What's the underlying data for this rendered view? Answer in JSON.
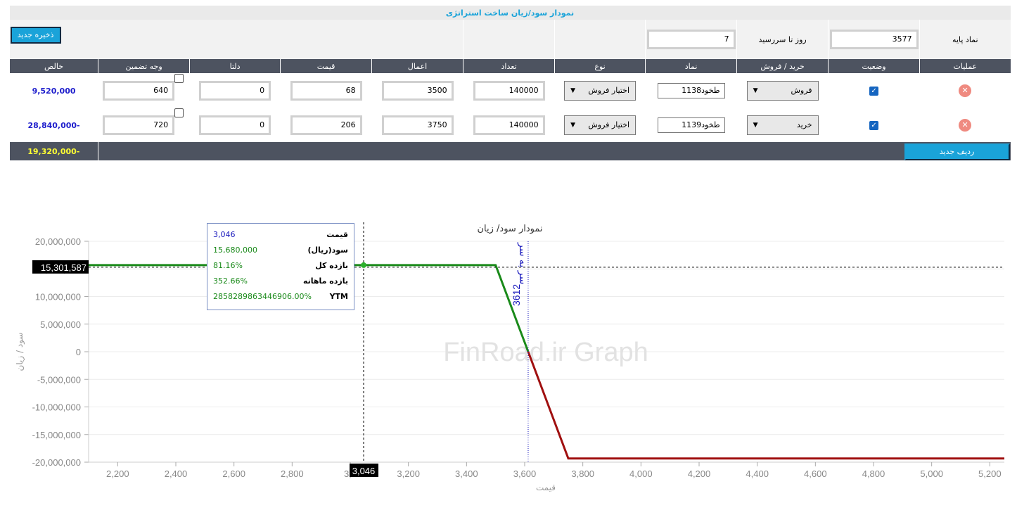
{
  "title": "نمودار سود/زیان ساخت استراتژی",
  "params": {
    "underlying_label": "نماد پایه",
    "underlying_value": "3577",
    "days_label": "روز تا سررسید",
    "days_value": "7",
    "save_label": "ذخیره جدید"
  },
  "columns": [
    "عملیات",
    "وضعیت",
    "خرید / فروش",
    "نماد",
    "نوع",
    "تعداد",
    "اعمال",
    "قیمت",
    "دلتا",
    "وجه تضمین",
    "خالص"
  ],
  "rows": [
    {
      "side": "فروش",
      "symbol": "طخود1138",
      "type": "اختیار فروش",
      "qty": "140000",
      "strike": "3500",
      "price": "68",
      "delta": "0",
      "margin": "640",
      "net": "9,520,000"
    },
    {
      "side": "خرید",
      "symbol": "طخود1139",
      "type": "اختیار فروش",
      "qty": "140000",
      "strike": "3750",
      "price": "206",
      "delta": "0",
      "margin": "720",
      "net": "-28,840,000"
    }
  ],
  "footer": {
    "net_total": "-19,320,000",
    "new_row_label": "ردیف جدید"
  },
  "icons": {
    "remove": "close-circle-icon",
    "status": "checkbox-checked-icon"
  },
  "colors": {
    "profit": "#1a8a1a",
    "loss": "#a01010",
    "header": "#4d5360",
    "accent": "#1aa3d9",
    "breakeven": "#1515bb"
  },
  "tooltip": {
    "rows": [
      {
        "label": "قیمت",
        "value": "3,046",
        "color": "#1515bb"
      },
      {
        "label": "سود(ریال)",
        "value": "15,680,000",
        "color": "#1a8a1a"
      },
      {
        "label": "بازده کل",
        "value": "81.16%",
        "color": "#1a8a1a"
      },
      {
        "label": "بازده ماهانه",
        "value": "352.66%",
        "color": "#1a8a1a"
      },
      {
        "label": "YTM",
        "value": "2858289863446906.00%",
        "color": "#1a8a1a"
      }
    ]
  },
  "chart_data": {
    "type": "line",
    "title": "نمودار سود/ زیان",
    "xlabel": "قیمت",
    "ylabel": "سود / زیان",
    "watermark": "FinRoad.ir Graph",
    "xlim": [
      2100,
      5250
    ],
    "ylim": [
      -20000000,
      20000000
    ],
    "x_ticks": [
      2200,
      2400,
      2600,
      2800,
      3000,
      3200,
      3400,
      3600,
      3800,
      4000,
      4200,
      4400,
      4600,
      4800,
      5000,
      5200
    ],
    "x_tick_labels": [
      "2,200",
      "2,400",
      "2,600",
      "2,800",
      "3,0",
      "3,200",
      "3,400",
      "3,600",
      "3,800",
      "4,000",
      "4,200",
      "4,400",
      "4,600",
      "4,800",
      "5,000",
      "5,200"
    ],
    "y_ticks": [
      20000000,
      15000000,
      10000000,
      5000000,
      0,
      -5000000,
      -10000000,
      -15000000,
      -20000000
    ],
    "y_tick_labels": [
      "20,000,000",
      "15,000,000",
      "10,000,000",
      "5,000,000",
      "0",
      "-5,000,000",
      "-10,000,000",
      "-15,000,000",
      "-20,000,000"
    ],
    "grid": true,
    "series": [
      {
        "x": [
          2100,
          3500,
          3612,
          3750,
          5250
        ],
        "y": [
          15680000,
          15680000,
          0,
          -19320000,
          -19320000
        ]
      }
    ],
    "breakeven": {
      "x": 3612,
      "label": "سر به سر",
      "value_label": "3612"
    },
    "crosshair": {
      "x": 3046,
      "y": 15301587,
      "x_label": "3,046",
      "y_label": "15,301,587"
    }
  }
}
